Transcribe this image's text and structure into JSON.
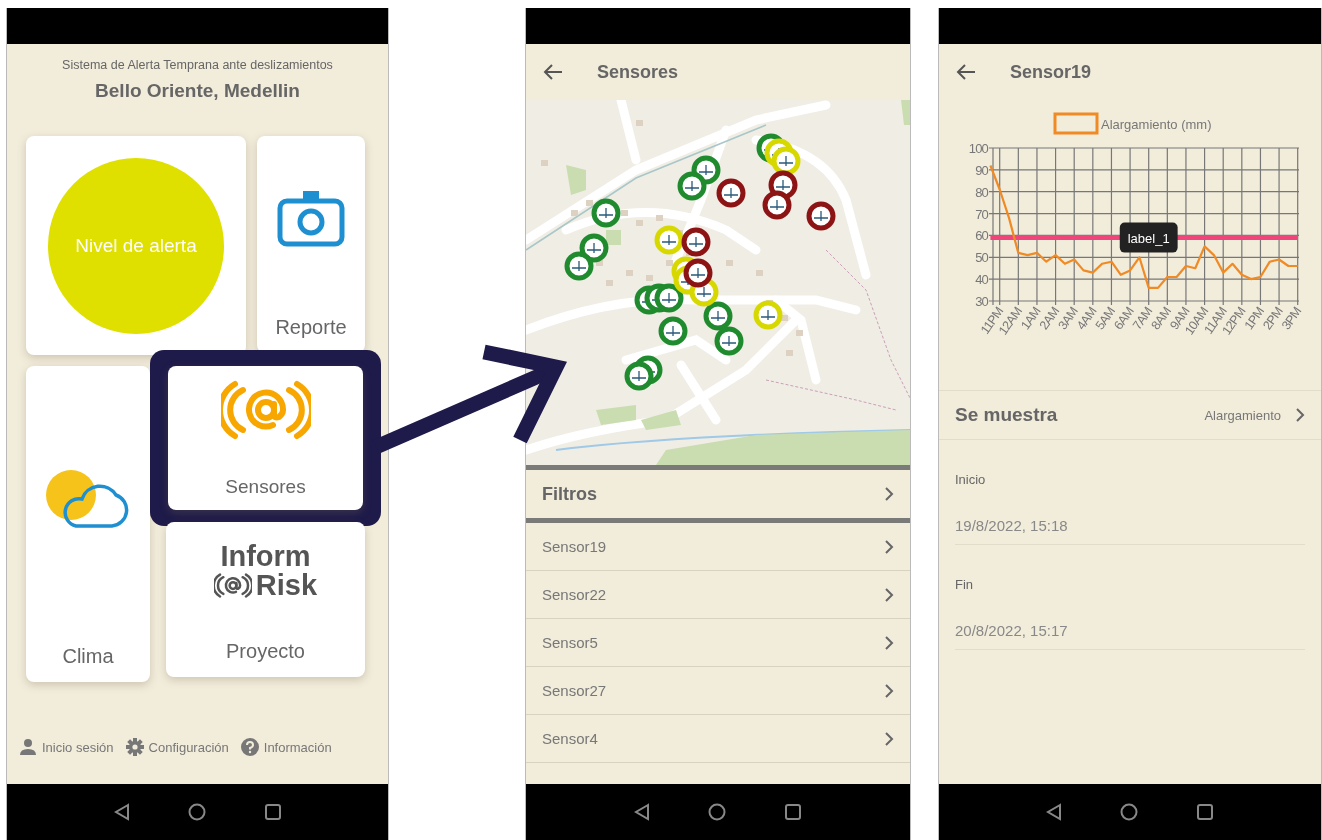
{
  "home": {
    "subtitle": "Sistema de Alerta Temprana ante deslizamientos",
    "title": "Bello Oriente, Medellin",
    "tiles": [
      {
        "kind": "alert",
        "label": "Nivel de alerta",
        "highlighted": false
      },
      {
        "kind": "report",
        "label": "Reporte",
        "highlighted": false
      },
      {
        "kind": "weather",
        "label": "Clima",
        "highlighted": false
      },
      {
        "kind": "sensors",
        "label": "Sensores",
        "highlighted": true
      },
      {
        "kind": "project",
        "label": "Proyecto",
        "logo_lines": [
          "Inform",
          "Risk"
        ],
        "highlighted": false
      }
    ],
    "footer": [
      {
        "kind": "user",
        "label": "Inicio sesión"
      },
      {
        "kind": "settings",
        "label": "Configuración"
      },
      {
        "kind": "help",
        "label": "Información"
      }
    ]
  },
  "sensors": {
    "title": "Sensores",
    "filter_label": "Filtros",
    "items": [
      "Sensor19",
      "Sensor22",
      "Sensor5",
      "Sensor27",
      "Sensor4"
    ]
  },
  "sensor_detail": {
    "title": "Sensor19",
    "chart_data": {
      "type": "line",
      "grid": true,
      "ylim": [
        30,
        100
      ],
      "yticks": [
        30,
        40,
        50,
        60,
        70,
        80,
        90,
        100
      ],
      "categories": [
        null,
        "11PM",
        null,
        "12AM",
        null,
        "1AM",
        null,
        "2AM",
        null,
        "3AM",
        null,
        "4AM",
        null,
        "5AM",
        null,
        "6AM",
        null,
        "7AM",
        null,
        "8AM",
        null,
        "9AM",
        null,
        "10AM",
        null,
        "11AM",
        null,
        "12PM",
        null,
        "1PM",
        null,
        "2PM",
        null,
        "3PM"
      ],
      "series": [
        {
          "name": "Alargamiento (mm)",
          "color": "#f08a24",
          "values": [
            92,
            81,
            68,
            52,
            51,
            52,
            48,
            51,
            47,
            49,
            44,
            43,
            47,
            48,
            42,
            44,
            50,
            36,
            36,
            41,
            41,
            46,
            45,
            55,
            51,
            43,
            47,
            42,
            40,
            41,
            48,
            49,
            46,
            46
          ]
        },
        {
          "name": "label_1",
          "color": "#f0457a",
          "values": [
            59,
            59,
            59,
            59,
            59,
            59,
            59,
            59,
            59,
            59,
            59,
            59,
            59,
            59,
            59,
            null,
            null,
            null,
            null,
            null,
            59,
            59,
            59,
            59,
            59,
            59,
            59,
            59,
            59,
            59,
            59,
            59,
            59,
            59
          ]
        }
      ]
    },
    "shown": {
      "label": "Se muestra",
      "value": "Alargamiento"
    },
    "fields": [
      {
        "label": "Inicio",
        "value": "19/8/2022, 15:18"
      },
      {
        "label": "Fin",
        "value": "20/8/2022, 15:17"
      }
    ]
  }
}
